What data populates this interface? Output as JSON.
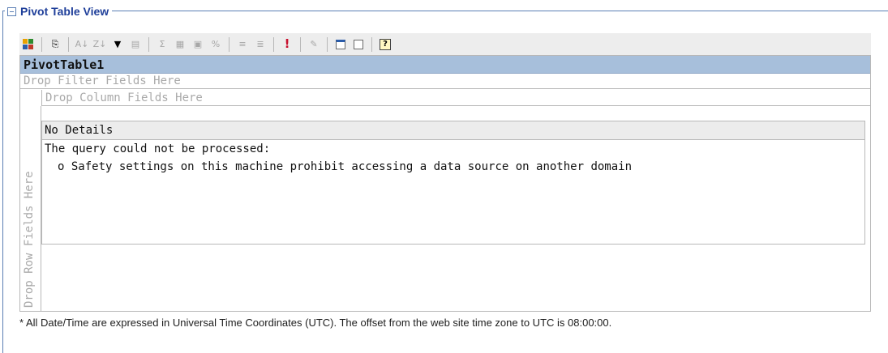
{
  "section": {
    "title": "Pivot Table View"
  },
  "toolbar": {
    "buttons": [
      {
        "icon": "field-list-icon"
      },
      {
        "icon": "copy-icon"
      },
      {
        "icon": "sort-ascending-icon"
      },
      {
        "icon": "sort-descending-icon"
      },
      {
        "icon": "autofilter-icon"
      },
      {
        "icon": "show-top-bottom-icon"
      },
      {
        "icon": "autocalc-icon"
      },
      {
        "icon": "subtotal-icon"
      },
      {
        "icon": "calculated-totals-icon"
      },
      {
        "icon": "show-as-icon"
      },
      {
        "icon": "collapse-icon"
      },
      {
        "icon": "expand-icon"
      },
      {
        "icon": "refresh-icon"
      },
      {
        "icon": "export-icon"
      },
      {
        "icon": "chart-icon"
      },
      {
        "icon": "commands-icon"
      },
      {
        "icon": "help-icon"
      }
    ]
  },
  "pivot": {
    "name": "PivotTable1",
    "drop_filter": "Drop Filter Fields Here",
    "drop_column": "Drop Column Fields Here",
    "drop_row": "Drop Row Fields Here",
    "details_header": "No Details",
    "error_message": "The query could not be processed:",
    "error_reason": "o Safety settings on this machine prohibit accessing a data source on another domain"
  },
  "footnote": "* All Date/Time are expressed in Universal Time Coordinates (UTC). The offset from the web site time zone to UTC is 08:00:00.",
  "colors": {
    "accent": "#1f3f9a",
    "title_bar": "#a7bfdb",
    "toolbar_bg": "#ededed"
  }
}
